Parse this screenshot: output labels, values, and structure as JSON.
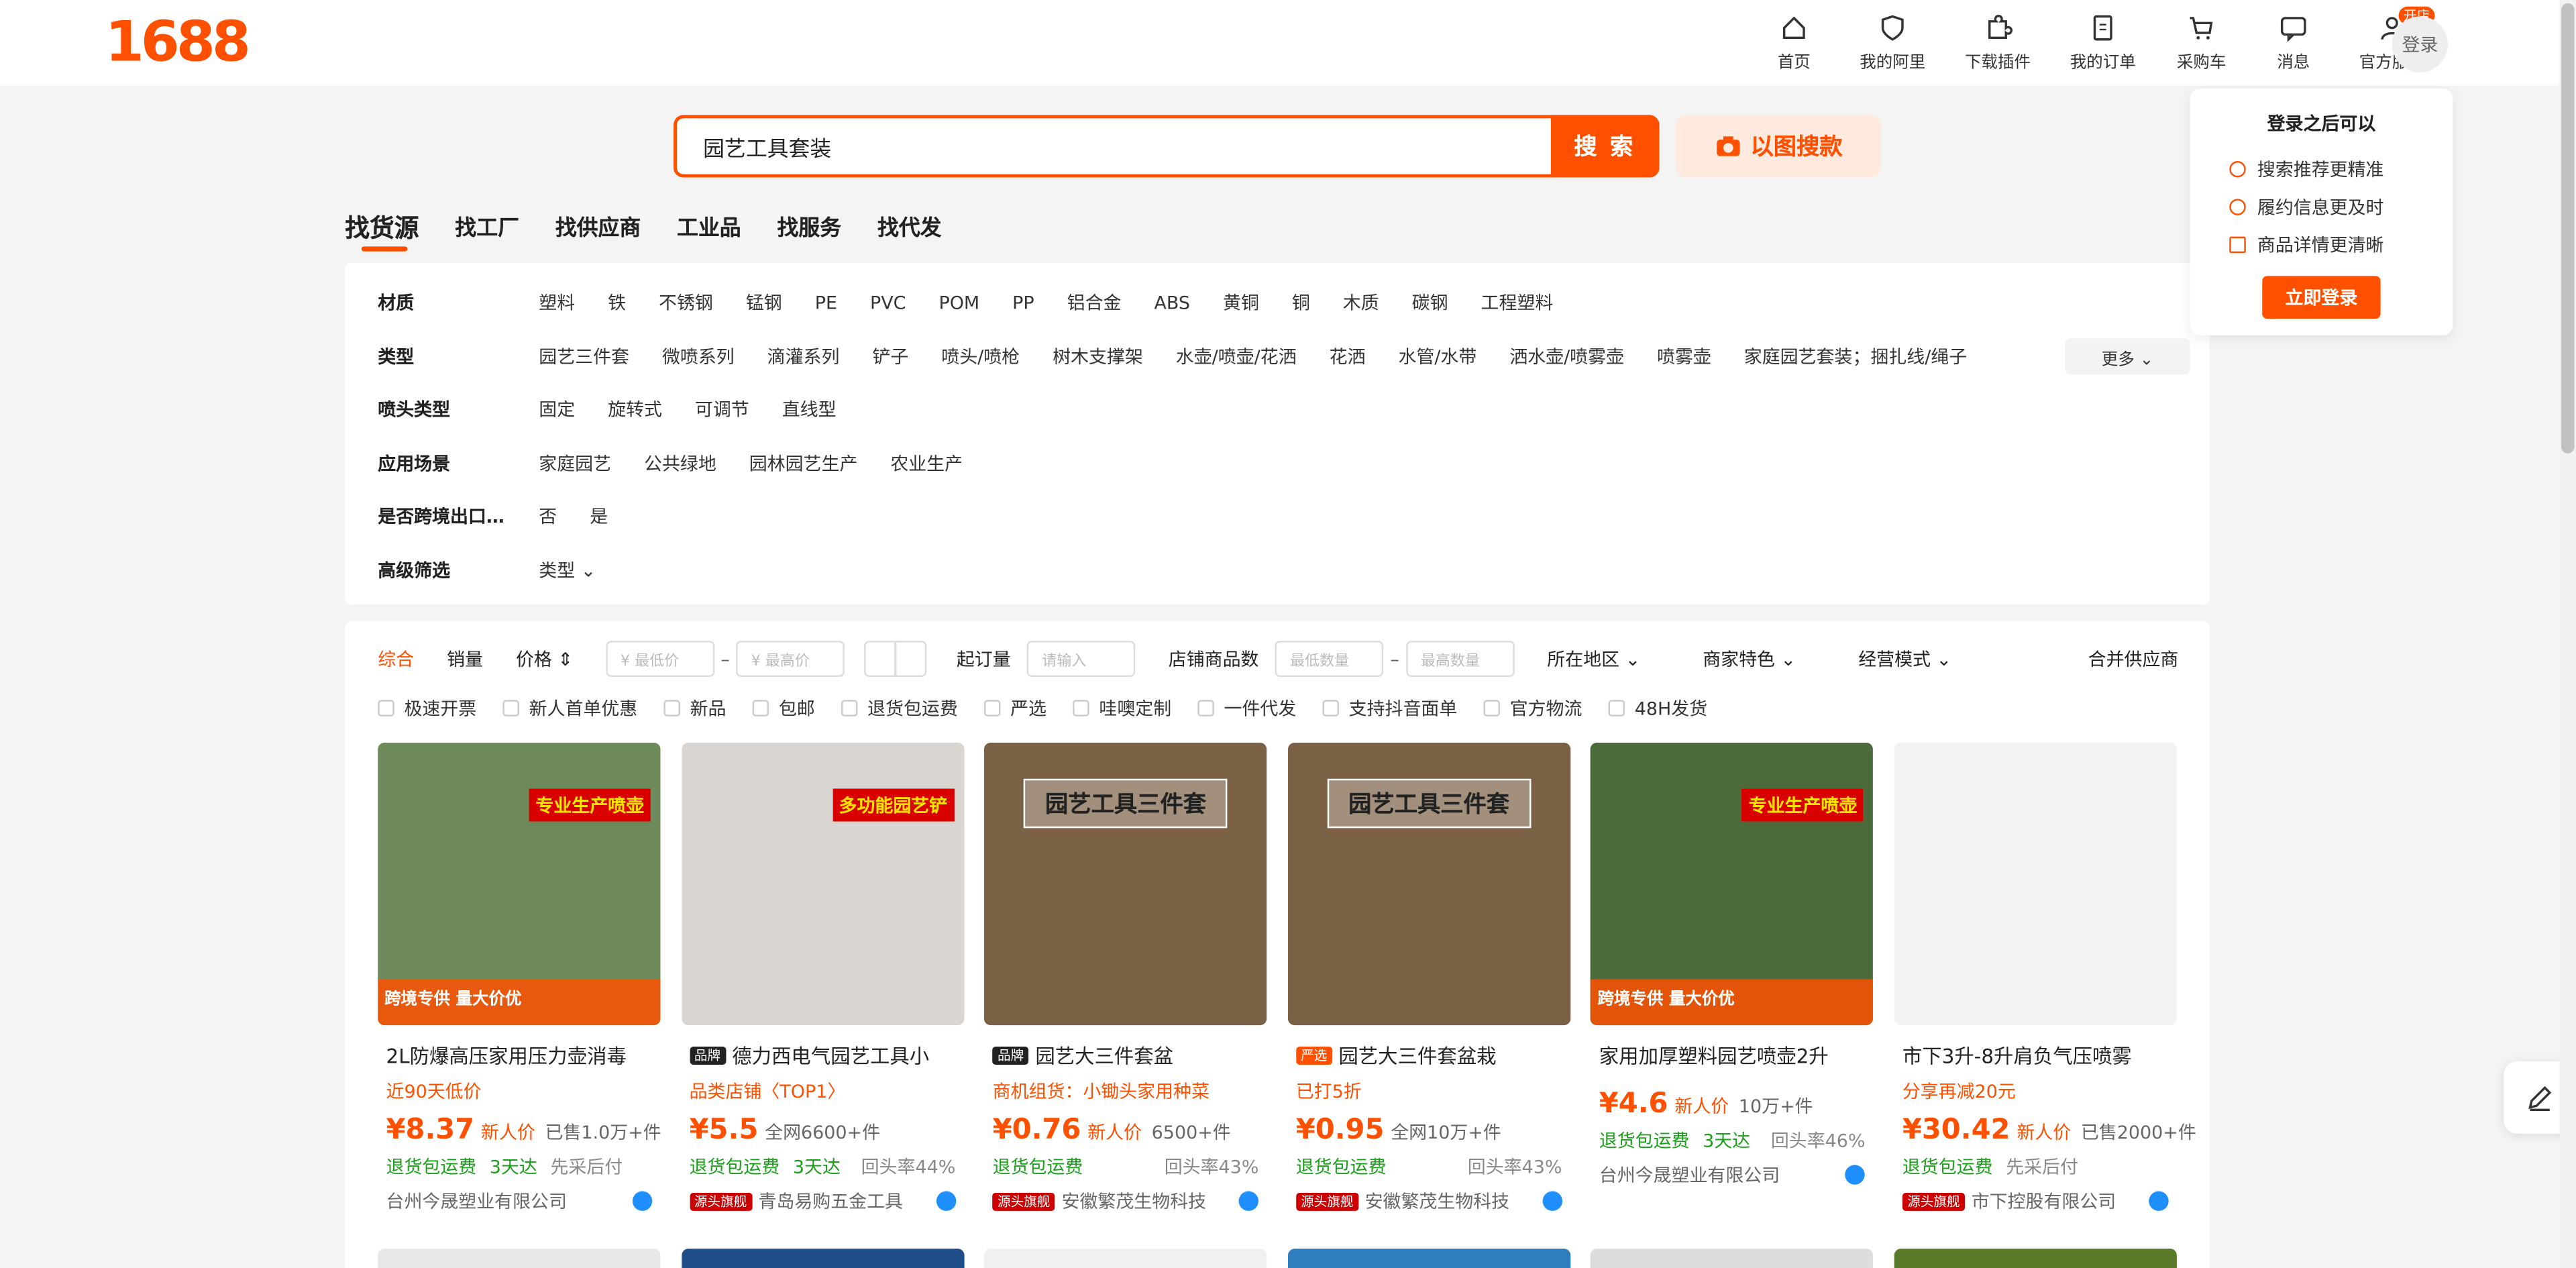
{
  "logo": "1688",
  "nav": [
    {
      "label": "首页",
      "icon": "home-icon"
    },
    {
      "label": "我的阿里",
      "icon": "heart-shield-icon"
    },
    {
      "label": "下载插件",
      "icon": "puzzle-icon"
    },
    {
      "label": "我的订单",
      "icon": "order-icon"
    },
    {
      "label": "采购车",
      "icon": "cart-icon"
    },
    {
      "label": "消息",
      "icon": "message-icon"
    },
    {
      "label": "官方服务",
      "icon": "service-icon",
      "badge": "开店"
    }
  ],
  "login_avatar": "登录",
  "login_popup": {
    "title": "登录之后可以",
    "items": [
      "搜索推荐更精准",
      "履约信息更及时",
      "商品详情更清晰"
    ],
    "button": "立即登录"
  },
  "search": {
    "value": "园艺工具套装",
    "button": "搜 索",
    "image_search": "以图搜款"
  },
  "tabs": [
    "找货源",
    "找工厂",
    "找供应商",
    "工业品",
    "找服务",
    "找代发"
  ],
  "filters": [
    {
      "label": "材质",
      "options": [
        "塑料",
        "铁",
        "不锈钢",
        "锰钢",
        "PE",
        "PVC",
        "POM",
        "PP",
        "铝合金",
        "ABS",
        "黄铜",
        "铜",
        "木质",
        "碳钢",
        "工程塑料"
      ]
    },
    {
      "label": "类型",
      "options": [
        "园艺三件套",
        "微喷系列",
        "滴灌系列",
        "铲子",
        "喷头/喷枪",
        "树木支撑架",
        "水壶/喷壶/花洒",
        "花洒",
        "水管/水带",
        "洒水壶/喷雾壶",
        "喷雾壶",
        "家庭园艺套装；捆扎线/绳子"
      ]
    },
    {
      "label": "喷头类型",
      "options": [
        "固定",
        "旋转式",
        "可调节",
        "直线型"
      ]
    },
    {
      "label": "应用场景",
      "options": [
        "家庭园艺",
        "公共绿地",
        "园林园艺生产",
        "农业生产"
      ]
    },
    {
      "label": "是否跨境出口…",
      "options": [
        "否",
        "是"
      ]
    },
    {
      "label": "高级筛选",
      "options": [
        "类型 ⌄"
      ]
    }
  ],
  "more_button": "更多 ⌄",
  "sortbar": {
    "comprehensive": "综合",
    "sales": "销量",
    "price": "价格 ⇕",
    "min_price": "¥ 最低价",
    "max_price": "¥ 最高价",
    "moq_label": "起订量",
    "moq_placeholder": "请输入",
    "shop_count_label": "店铺商品数",
    "min_qty": "最低数量",
    "max_qty": "最高数量",
    "region": "所在地区 ⌄",
    "features": "商家特色 ⌄",
    "mode": "经营模式 ⌄",
    "merge": "合并供应商"
  },
  "checkboxes": [
    "极速开票",
    "新人首单优惠",
    "新品",
    "包邮",
    "退货包运费",
    "严选",
    "哇噢定制",
    "一件代发",
    "支持抖音面单",
    "官方物流",
    "48H发货"
  ],
  "products": [
    {
      "title": "2L防爆高压家用压力壶消毒",
      "tag": "",
      "sub": "近90天低价",
      "price": "¥8.37",
      "price_int": "8",
      "price_dec": ".37",
      "new": "新人价",
      "sold": "已售1.0万+件",
      "serv": [
        "退货包运费",
        "3天达"
      ],
      "serv_gray": "先采后付",
      "rate": "",
      "shop": "台州今晟塑业有限公司",
      "shop_tag": "",
      "thumb_bg": "#6f8a5a",
      "overlay": "跨境专供 量大价优",
      "corner": "专业生产喷壶"
    },
    {
      "title": "德力西电气园艺工具小",
      "tag": "品牌",
      "sub": "品类店铺〈TOP1〉",
      "price": "¥5.5",
      "price_int": "5",
      "price_dec": ".5",
      "new": "",
      "sold": "全网6600+件",
      "serv": [
        "退货包运费",
        "3天达"
      ],
      "serv_gray": "",
      "rate": "回头率44%",
      "shop": "青岛易购五金工具",
      "shop_tag": "源头旗舰",
      "thumb_bg": "#d9d6d2",
      "overlay": "",
      "corner": "多功能园艺铲"
    },
    {
      "title": "园艺大三件套盆",
      "tag": "品牌",
      "sub": "商机组货：小锄头家用种菜",
      "price": "¥0.76",
      "price_int": "0",
      "price_dec": ".76",
      "new": "新人价",
      "sold": "6500+件",
      "serv": [
        "退货包运费"
      ],
      "serv_gray": "",
      "rate": "回头率43%",
      "shop": "安徽繁茂生物科技",
      "shop_tag": "源头旗舰",
      "thumb_bg": "#7a6044",
      "overlay": "",
      "corner": "园艺工具三件套"
    },
    {
      "title": "园艺大三件套盆栽",
      "tag": "严选",
      "sub": "已打5折",
      "price": "¥0.95",
      "price_int": "0",
      "price_dec": ".95",
      "new": "",
      "sold": "全网10万+件",
      "serv": [
        "退货包运费"
      ],
      "serv_gray": "",
      "rate": "回头率43%",
      "shop": "安徽繁茂生物科技",
      "shop_tag": "源头旗舰",
      "thumb_bg": "#7a6044",
      "overlay": "",
      "corner": "园艺工具三件套"
    },
    {
      "title": "家用加厚塑料园艺喷壶2升",
      "tag": "",
      "sub": "",
      "price": "¥4.6",
      "price_int": "4",
      "price_dec": ".6",
      "new": "新人价",
      "sold": "10万+件",
      "serv": [
        "退货包运费",
        "3天达"
      ],
      "serv_gray": "",
      "rate": "回头率46%",
      "shop": "台州今晟塑业有限公司",
      "shop_tag": "",
      "thumb_bg": "#4d6b3a",
      "overlay": "跨境专供 量大价优",
      "corner": "专业生产喷壶"
    },
    {
      "title": "市下3升-8升肩负气压喷雾",
      "tag": "",
      "sub": "分享再减20元",
      "price": "¥30.42",
      "price_int": "30",
      "price_dec": ".42",
      "new": "新人价",
      "sold": "已售2000+件",
      "serv": [
        "退货包运费"
      ],
      "serv_gray": "先采后付",
      "rate": "",
      "shop": "市下控股有限公司",
      "shop_tag": "源头旗舰",
      "thumb_bg": "#f2f2f2",
      "overlay": "",
      "corner": ""
    }
  ],
  "next_row_colors": [
    "#e8e8e8",
    "#1f4d8a",
    "#f0f0f0",
    "#2f7fc0",
    "#ddd",
    "#5a7a2a"
  ]
}
